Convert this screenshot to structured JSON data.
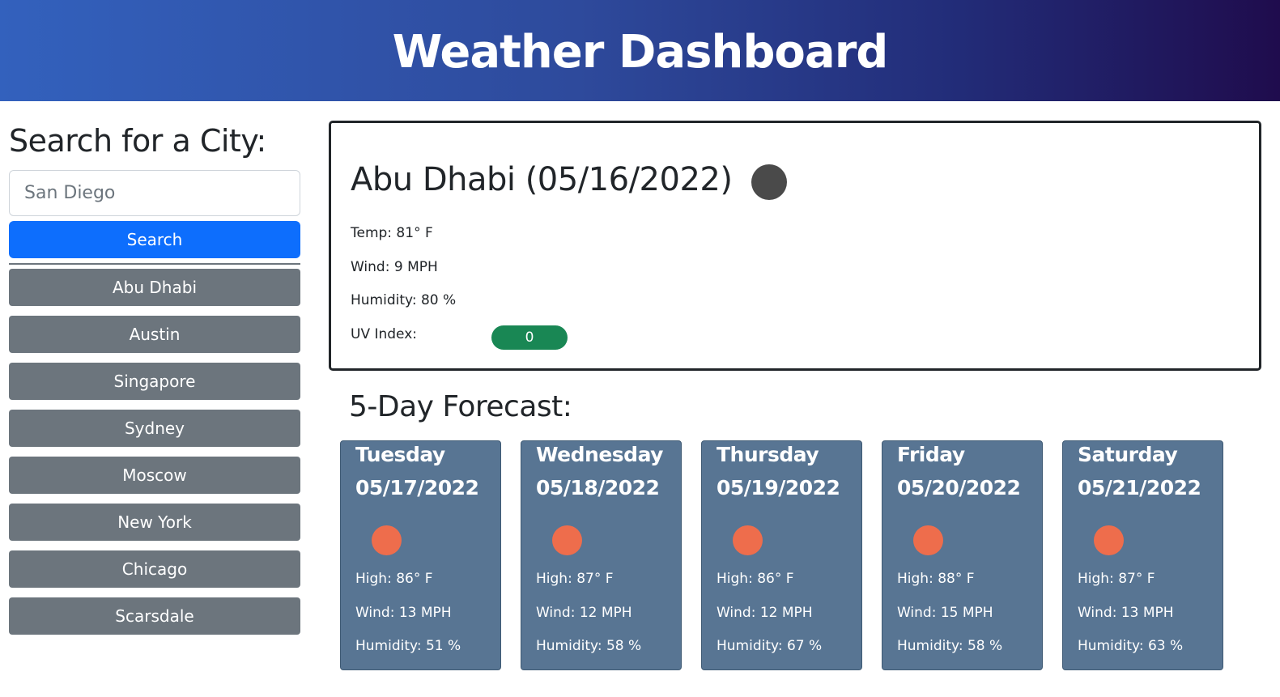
{
  "header": {
    "title": "Weather Dashboard"
  },
  "sidebar": {
    "heading": "Search for a City:",
    "search": {
      "value": "",
      "placeholder": "San Diego"
    },
    "search_button_label": "Search",
    "history": [
      "Abu Dhabi",
      "Austin",
      "Singapore",
      "Sydney",
      "Moscow",
      "New York",
      "Chicago",
      "Scarsdale"
    ]
  },
  "current": {
    "title": "Abu Dhabi (05/16/2022)",
    "icon": "weather-icon",
    "temp": "Temp: 81° F",
    "wind": "Wind: 9 MPH",
    "humidity": "Humidity: 80 %",
    "uv_label": "UV Index:",
    "uv_value": "0",
    "uv_color": "#198754"
  },
  "forecast": {
    "title": "5-Day Forecast:",
    "days": [
      {
        "day": "Tuesday",
        "date": "05/17/2022",
        "high": "High: 86° F",
        "wind": "Wind: 13 MPH",
        "humidity": "Humidity: 51 %"
      },
      {
        "day": "Wednesday",
        "date": "05/18/2022",
        "high": "High: 87° F",
        "wind": "Wind: 12 MPH",
        "humidity": "Humidity: 58 %"
      },
      {
        "day": "Thursday",
        "date": "05/19/2022",
        "high": "High: 86° F",
        "wind": "Wind: 12 MPH",
        "humidity": "Humidity: 67 %"
      },
      {
        "day": "Friday",
        "date": "05/20/2022",
        "high": "High: 88° F",
        "wind": "Wind: 15 MPH",
        "humidity": "Humidity: 58 %"
      },
      {
        "day": "Saturday",
        "date": "05/21/2022",
        "high": "High: 87° F",
        "wind": "Wind: 13 MPH",
        "humidity": "Humidity: 63 %"
      }
    ]
  },
  "colors": {
    "accent": "#0d6efd",
    "history_button": "#6c757d",
    "card_bg": "#587593",
    "sun_icon": "#ee6d4c"
  }
}
